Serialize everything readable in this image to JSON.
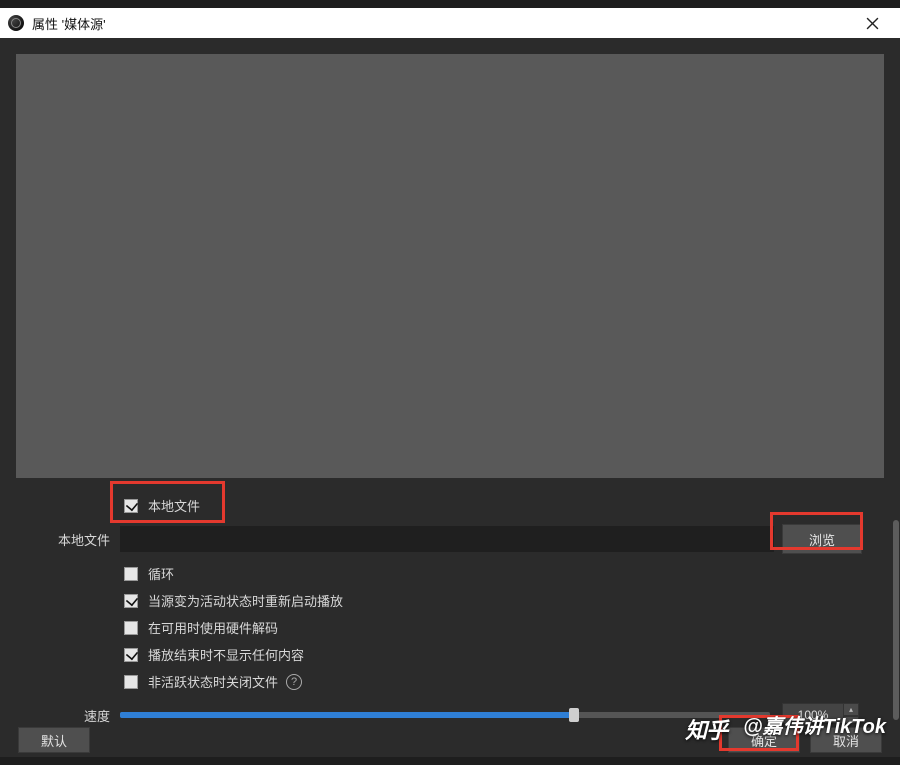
{
  "titlebar": {
    "title": "属性 '媒体源'"
  },
  "props": {
    "local_file_checkbox_label": "本地文件",
    "local_file_field_label": "本地文件",
    "browse_label": "浏览",
    "file_path": "",
    "loop_label": "循环",
    "restart_label": "当源变为活动状态时重新启动播放",
    "hwdecode_label": "在可用时使用硬件解码",
    "end_hide_label": "播放结束时不显示任何内容",
    "close_inactive_label": "非活跃状态时关闭文件",
    "speed_label": "速度",
    "speed_value": "100%",
    "checked": {
      "local_file": true,
      "loop": false,
      "restart": true,
      "hwdecode": false,
      "end_hide": true,
      "close_inactive": false
    }
  },
  "buttons": {
    "defaults": "默认",
    "ok": "确定",
    "cancel": "取消"
  },
  "watermark": {
    "brand": "知乎",
    "text": "@嘉伟讲TikTok"
  }
}
